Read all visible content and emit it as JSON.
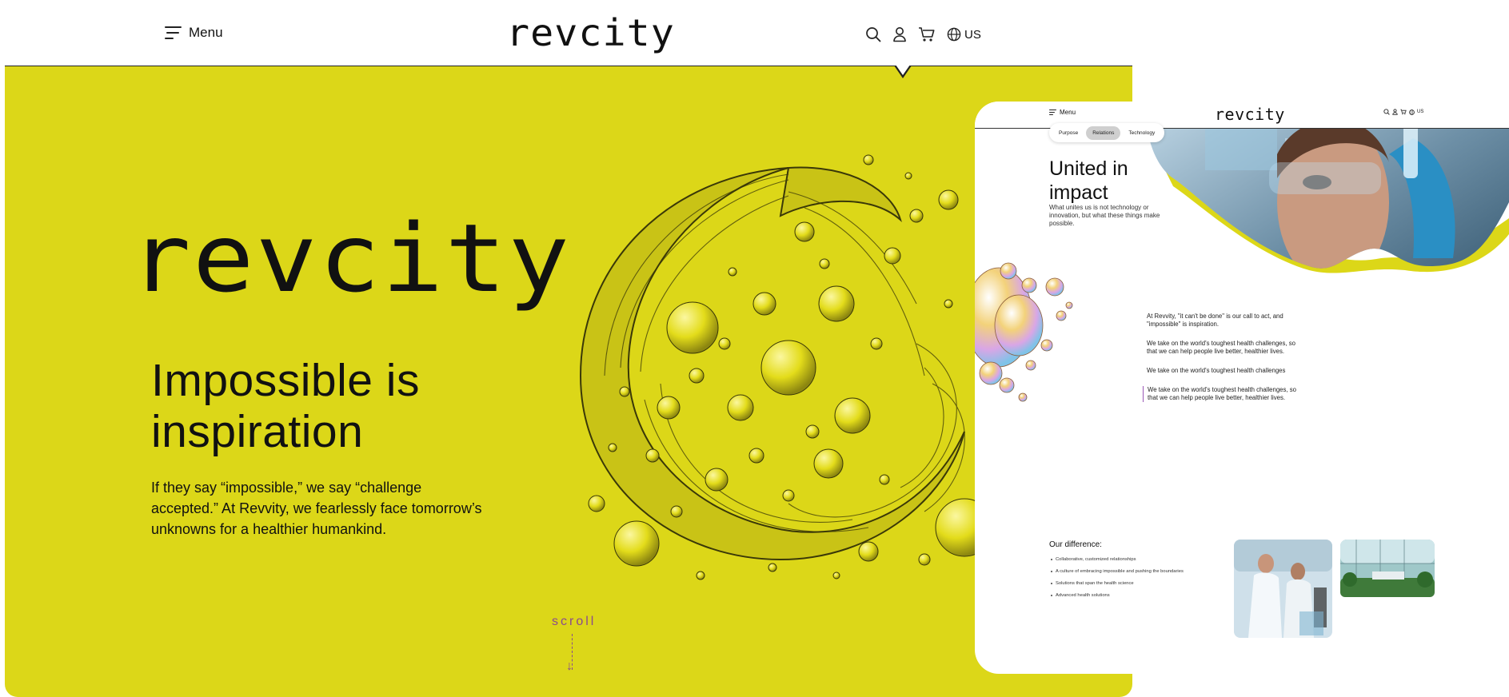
{
  "main_page": {
    "header": {
      "menu_label": "Menu",
      "logo_text": "revcity",
      "icons": [
        "search-icon",
        "user-icon",
        "cart-icon",
        "globe-icon"
      ],
      "locale": "US"
    },
    "hero": {
      "brand_text": "revcity",
      "title_line1": "Impossible is",
      "title_line2": "inspiration",
      "body": "If they say “impossible,” we say “challenge accepted.” At Revvity, we fearlessly face tomorrow’s unknowns for a healthier humankind.",
      "scroll_label": "scroll"
    },
    "colors": {
      "background": "#dcd718",
      "accent": "#8a4a8e",
      "text": "#111111"
    }
  },
  "overlay_page": {
    "header": {
      "menu_label": "Menu",
      "logo_text": "revcity",
      "icons": [
        "search-icon",
        "user-icon",
        "cart-icon",
        "globe-icon"
      ],
      "locale": "US"
    },
    "tabs": [
      {
        "label": "Purpose",
        "active": false
      },
      {
        "label": "Relations",
        "active": true
      },
      {
        "label": "Technology",
        "active": false
      }
    ],
    "title_line1": "United in",
    "title_line2": "impact",
    "subtitle": "What unites us is not technology or innovation, but what these things make possible.",
    "paragraphs": [
      "At Revvity, \"it can't be done\" is our call to act, and \"impossible\" is inspiration.",
      "We take on the world's toughest health challenges, so that we can help people live better, healthier lives.",
      "We take on the world's toughest health challenges",
      "We take on the world's toughest health challenges, so that we can help people live better, healthier lives."
    ],
    "difference_title": "Our difference:",
    "difference_items": [
      "Collaborative, customized relationships",
      "A culture of embracing impossible and pushing the boundaries",
      "Solutions that span the health science",
      "Advanced health solutions"
    ]
  }
}
